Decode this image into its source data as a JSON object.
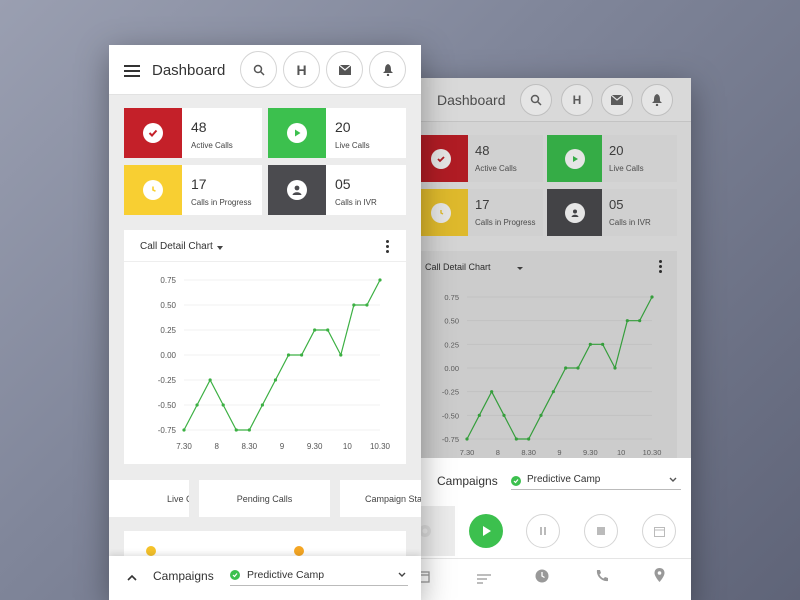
{
  "colors": {
    "red": "#c42029",
    "green": "#3cc04e",
    "yellow": "#f8cf32",
    "dark": "#4b4b4f",
    "line": "#3cb043"
  },
  "header": {
    "title": "Dashboard",
    "h_label": "H",
    "icons": [
      "menu-icon",
      "search-icon",
      "h-icon",
      "mail-icon",
      "bell-icon"
    ]
  },
  "stats": [
    {
      "value": "48",
      "label": "Active Calls",
      "icon": "check-icon",
      "color": "red"
    },
    {
      "value": "20",
      "label": "Live Calls",
      "icon": "play-icon",
      "color": "green"
    },
    {
      "value": "17",
      "label": "Calls in Progress",
      "icon": "clock-icon",
      "color": "yellow"
    },
    {
      "value": "05",
      "label": "Calls in IVR",
      "icon": "user-icon",
      "color": "dark"
    }
  ],
  "chart_title": "Call Detail Chart",
  "chart_data": {
    "type": "line",
    "x": [
      7.3,
      7.45,
      8,
      8.15,
      8.3,
      8.45,
      9,
      9.15,
      9.3,
      9.45,
      10,
      10.15,
      10.3
    ],
    "xticks": [
      "7.30",
      "8",
      "8.30",
      "9",
      "9.30",
      "10",
      "10.30"
    ],
    "yticks": [
      "0.75",
      "0.50",
      "0.25",
      "0.00",
      "-0.25",
      "-0.50",
      "-0.75"
    ],
    "ylim": [
      -0.75,
      0.75
    ],
    "series": [
      {
        "values": [
          -0.75,
          -0.5,
          -0.25,
          -0.5,
          -0.75,
          -0.75,
          -0.5,
          -0.25,
          0.0,
          0.0,
          0.25,
          0.25,
          0.0,
          0.5,
          0.5,
          0.75
        ]
      }
    ],
    "grid": true
  },
  "tabs": [
    "Live Calls",
    "Pending Calls",
    "Campaign Status"
  ],
  "campaigns": {
    "label": "Campaigns",
    "selected": "Predictive Camp"
  },
  "controls": [
    "settings-icon",
    "play-icon",
    "pause-icon",
    "stop-icon",
    "calendar-icon"
  ],
  "bottom_nav": [
    "calendar-icon",
    "sort-icon",
    "clock-icon",
    "phone-icon",
    "location-icon"
  ]
}
